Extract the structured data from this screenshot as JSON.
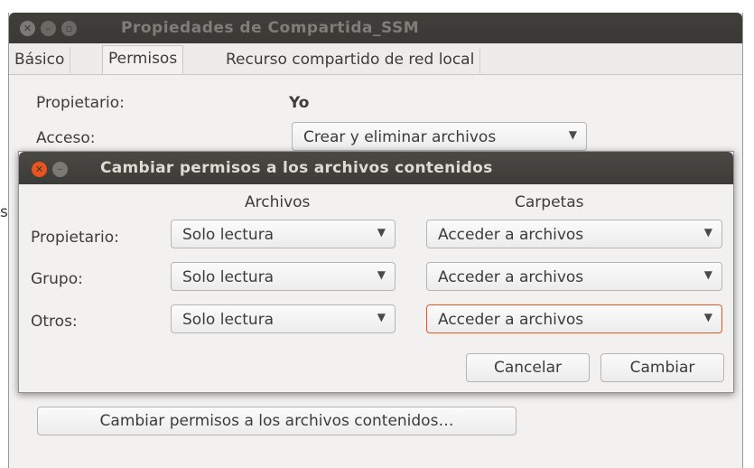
{
  "window": {
    "title": "Propiedades de Compartida_SSM",
    "tabs": [
      {
        "label": "Básico"
      },
      {
        "label": "Permisos"
      },
      {
        "label": "Recurso compartido de red local"
      }
    ],
    "active_tab": "Permisos",
    "owner_label": "Propietario:",
    "owner_value": "Yo",
    "access_label": "Acceso:",
    "access_value": "Crear y eliminar archivos",
    "change_contents_button": "Cambiar permisos a los archivos contenidos…",
    "partial_char": "s"
  },
  "dialog": {
    "title": "Cambiar permisos a los archivos contenidos",
    "col_files": "Archivos",
    "col_folders": "Carpetas",
    "rows": [
      {
        "label": "Propietario:",
        "files": "Solo lectura",
        "folders": "Acceder a archivos"
      },
      {
        "label": "Grupo:",
        "files": "Solo lectura",
        "folders": "Acceder a archivos"
      },
      {
        "label": "Otros:",
        "files": "Solo lectura",
        "folders": "Acceder a archivos"
      }
    ],
    "cancel_label": "Cancelar",
    "change_label": "Cambiar"
  },
  "colors": {
    "accent": "#e95420",
    "titlebar": "#3c3b37",
    "window_bg": "#f2f1f0"
  }
}
